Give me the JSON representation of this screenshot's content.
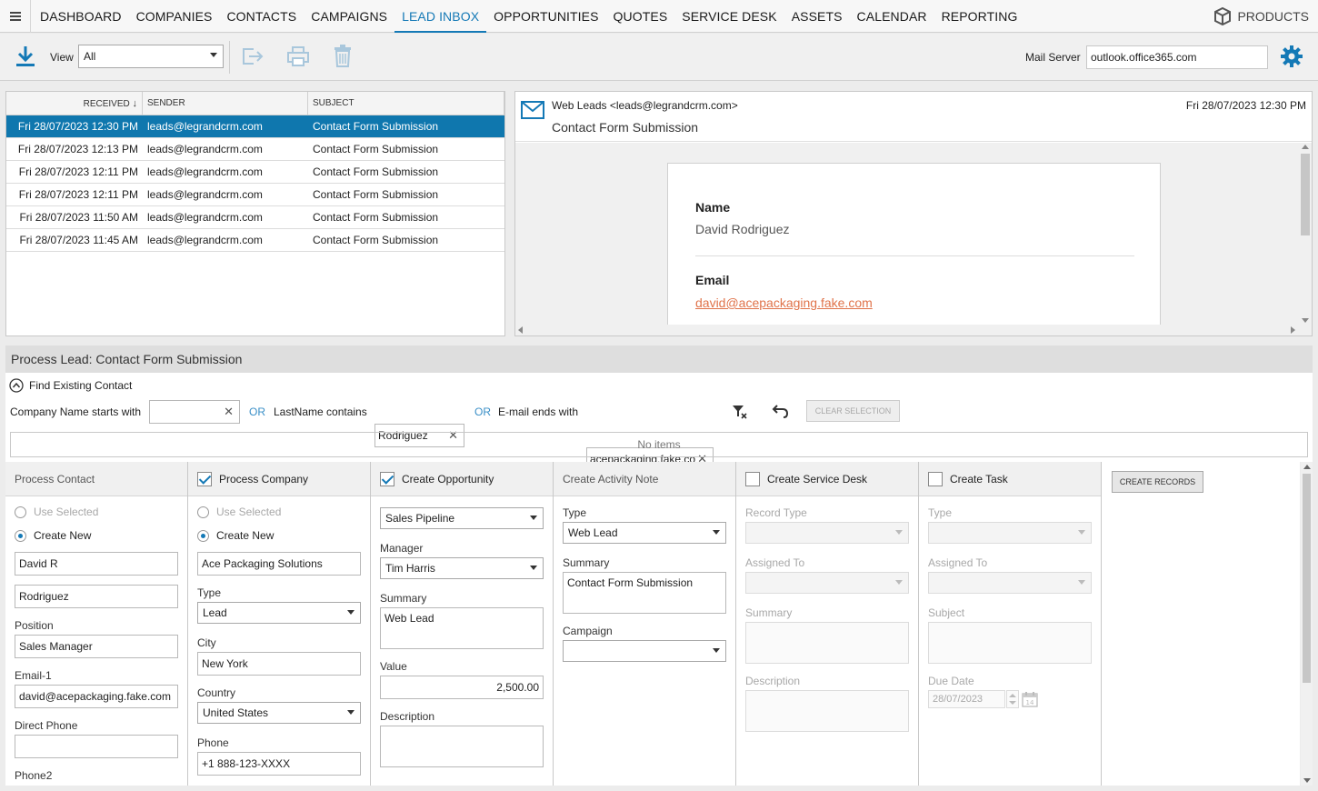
{
  "nav": {
    "items": [
      "DASHBOARD",
      "COMPANIES",
      "CONTACTS",
      "CAMPAIGNS",
      "LEAD INBOX",
      "OPPORTUNITIES",
      "QUOTES",
      "SERVICE DESK",
      "ASSETS",
      "CALENDAR",
      "REPORTING"
    ],
    "active": "LEAD INBOX",
    "products": "PRODUCTS"
  },
  "toolbar": {
    "view_label": "View",
    "view_value": "All",
    "mail_server_label": "Mail Server",
    "mail_server_value": "outlook.office365.com"
  },
  "maillist": {
    "headers": {
      "received": "RECEIVED",
      "sender": "SENDER",
      "subject": "SUBJECT"
    },
    "rows": [
      {
        "received": "Fri 28/07/2023 12:30 PM",
        "sender": "leads@legrandcrm.com",
        "subject": "Contact Form Submission"
      },
      {
        "received": "Fri 28/07/2023 12:13 PM",
        "sender": "leads@legrandcrm.com",
        "subject": "Contact Form Submission"
      },
      {
        "received": "Fri 28/07/2023 12:11 PM",
        "sender": "leads@legrandcrm.com",
        "subject": "Contact Form Submission"
      },
      {
        "received": "Fri 28/07/2023 12:11 PM",
        "sender": "leads@legrandcrm.com",
        "subject": "Contact Form Submission"
      },
      {
        "received": "Fri 28/07/2023 11:50 AM",
        "sender": "leads@legrandcrm.com",
        "subject": "Contact Form Submission"
      },
      {
        "received": "Fri 28/07/2023 11:45 AM",
        "sender": "leads@legrandcrm.com",
        "subject": "Contact Form Submission"
      }
    ]
  },
  "preview": {
    "from": "Web Leads <leads@legrandcrm.com>",
    "subject": "Contact Form Submission",
    "date": "Fri 28/07/2023 12:30 PM",
    "name_label": "Name",
    "name_value": "David Rodriguez",
    "email_label": "Email",
    "email_value": "david@acepackaging.fake.com"
  },
  "process": {
    "title_prefix": "Process Lead:",
    "title_subject": "Contact Form Submission",
    "find_label": "Find Existing Contact",
    "company_label": "Company Name starts with",
    "company_value": "",
    "or": "OR",
    "lastname_label": "LastName contains",
    "lastname_value": "Rodriguez",
    "email_label": "E-mail ends with",
    "email_value": "acepackaging.fake.co",
    "clear_selection": "CLEAR SELECTION",
    "no_items": "No items",
    "create_records": "CREATE RECORDS"
  },
  "contact": {
    "title": "Process Contact",
    "use_selected": "Use Selected",
    "create_new": "Create New",
    "first_name": "David R",
    "last_name": "Rodriguez",
    "position_label": "Position",
    "position": "Sales Manager",
    "email1_label": "Email-1",
    "email1": "david@acepackaging.fake.com",
    "direct_phone_label": "Direct Phone",
    "direct_phone": "",
    "phone2_label": "Phone2"
  },
  "company": {
    "title": "Process Company",
    "use_selected": "Use Selected",
    "create_new": "Create New",
    "name": "Ace Packaging Solutions",
    "type_label": "Type",
    "type": "Lead",
    "city_label": "City",
    "city": "New York",
    "country_label": "Country",
    "country": "United States",
    "phone_label": "Phone",
    "phone": "+1 888-123-XXXX"
  },
  "opportunity": {
    "title": "Create Opportunity",
    "pipeline": "Sales Pipeline",
    "manager_label": "Manager",
    "manager": "Tim Harris",
    "summary_label": "Summary",
    "summary": "Web Lead",
    "value_label": "Value",
    "value": "2,500.00",
    "description_label": "Description"
  },
  "activity": {
    "title": "Create Activity Note",
    "type_label": "Type",
    "type": "Web Lead",
    "summary_label": "Summary",
    "summary": "Contact Form Submission",
    "campaign_label": "Campaign"
  },
  "servicedesk": {
    "title": "Create Service Desk",
    "record_type_label": "Record Type",
    "assigned_label": "Assigned To",
    "summary_label": "Summary",
    "description_label": "Description"
  },
  "task": {
    "title": "Create Task",
    "type_label": "Type",
    "assigned_label": "Assigned To",
    "subject_label": "Subject",
    "due_label": "Due Date",
    "due_value": "28/07/2023"
  },
  "colors": {
    "accent": "#1479b6",
    "selected_row": "#0f77ae",
    "link": "#e0734a"
  }
}
